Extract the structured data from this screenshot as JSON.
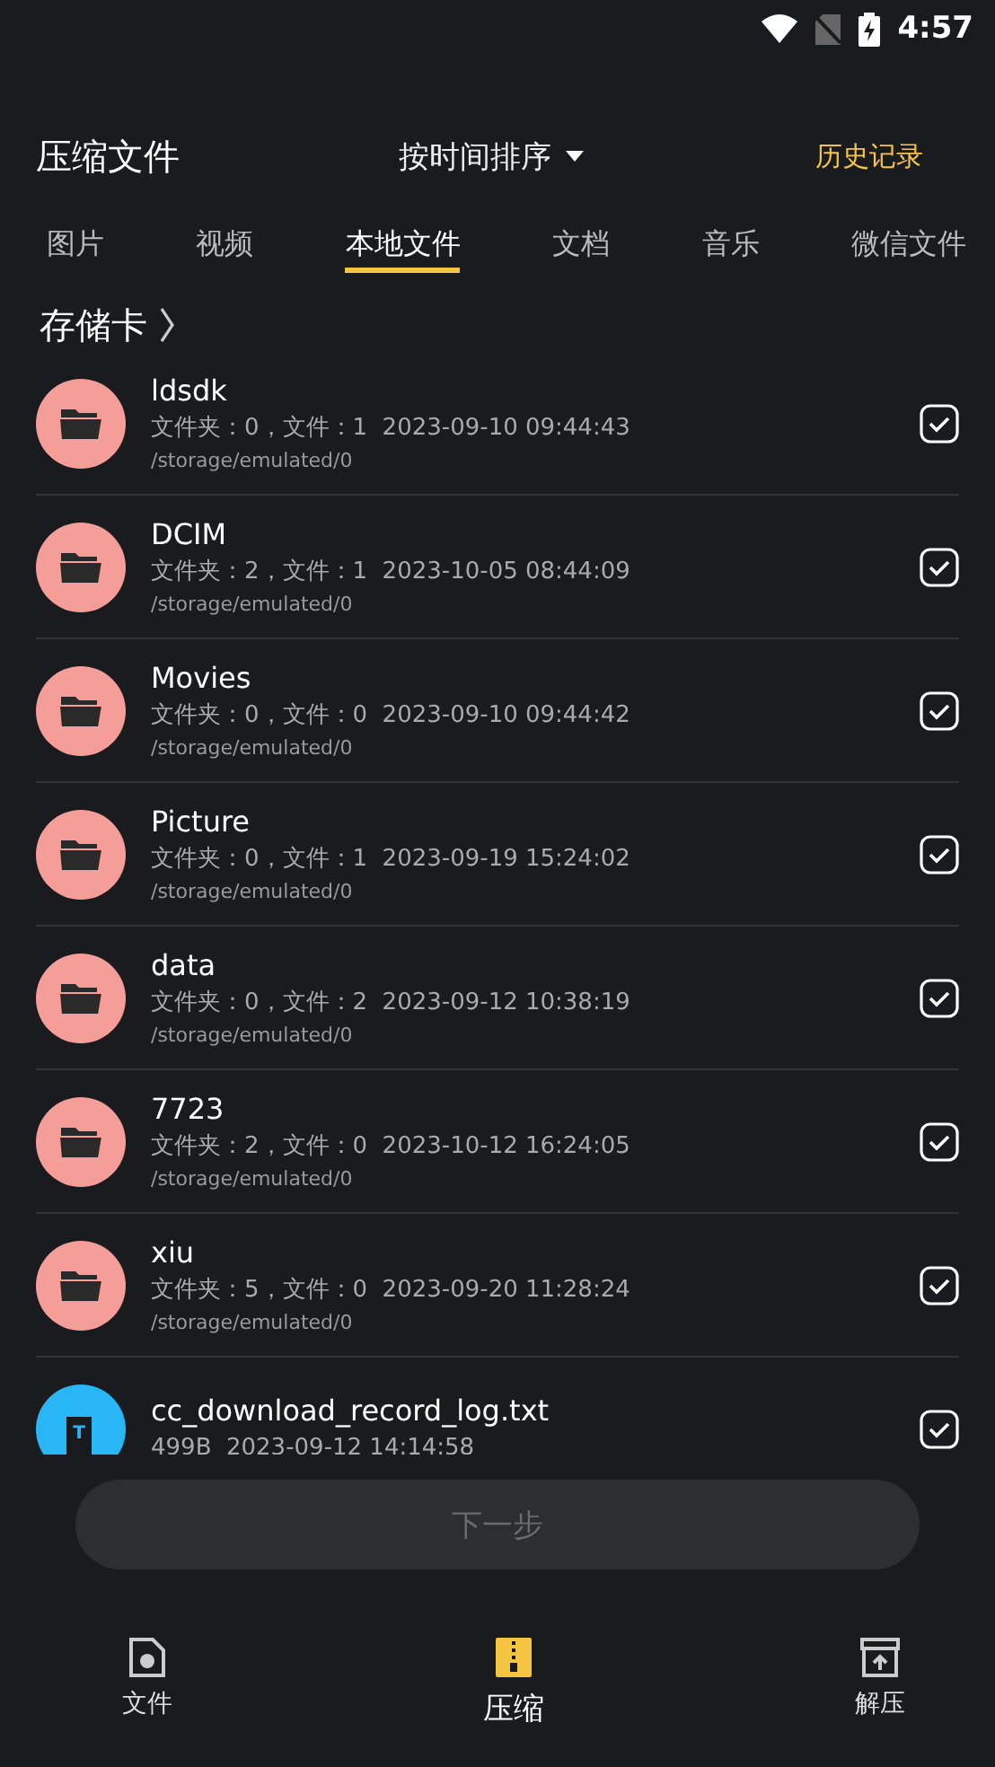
{
  "status_bar": {
    "time": "4:57"
  },
  "header": {
    "title": "压缩文件",
    "sort": "按时间排序",
    "history": "历史记录"
  },
  "tabs": [
    {
      "label": "图片",
      "selected": false
    },
    {
      "label": "视频",
      "selected": false
    },
    {
      "label": "本地文件",
      "selected": true
    },
    {
      "label": "文档",
      "selected": false
    },
    {
      "label": "音乐",
      "selected": false
    },
    {
      "label": "微信文件",
      "selected": false
    }
  ],
  "breadcrumb": "存储卡",
  "files": [
    {
      "kind": "folder",
      "name": "ldsdk",
      "info": "文件夹：0，文件：1",
      "date": "2023-09-10 09:44:43",
      "path": "/storage/emulated/0",
      "checked": true
    },
    {
      "kind": "folder",
      "name": "DCIM",
      "info": "文件夹：2，文件：1",
      "date": "2023-10-05 08:44:09",
      "path": "/storage/emulated/0",
      "checked": true
    },
    {
      "kind": "folder",
      "name": "Movies",
      "info": "文件夹：0，文件：0",
      "date": "2023-09-10 09:44:42",
      "path": "/storage/emulated/0",
      "checked": true
    },
    {
      "kind": "folder",
      "name": "Picture",
      "info": "文件夹：0，文件：1",
      "date": "2023-09-19 15:24:02",
      "path": "/storage/emulated/0",
      "checked": true
    },
    {
      "kind": "folder",
      "name": "data",
      "info": "文件夹：0，文件：2",
      "date": "2023-09-12 10:38:19",
      "path": "/storage/emulated/0",
      "checked": true
    },
    {
      "kind": "folder",
      "name": "7723",
      "info": "文件夹：2，文件：0",
      "date": "2023-10-12 16:24:05",
      "path": "/storage/emulated/0",
      "checked": true
    },
    {
      "kind": "folder",
      "name": "xiu",
      "info": "文件夹：5，文件：0",
      "date": "2023-09-20 11:28:24",
      "path": "/storage/emulated/0",
      "checked": true
    },
    {
      "kind": "text",
      "name": "cc_download_record_log.txt",
      "info": "499B",
      "date": "2023-09-12 14:14:58",
      "icon_letter": "T",
      "checked": true
    }
  ],
  "next_button": {
    "label": "下一步",
    "disabled": true
  },
  "nav": [
    {
      "label": "文件",
      "kind": "file",
      "selected": false
    },
    {
      "label": "压缩",
      "kind": "zip",
      "selected": true
    },
    {
      "label": "解压",
      "kind": "unpack",
      "selected": false
    }
  ]
}
